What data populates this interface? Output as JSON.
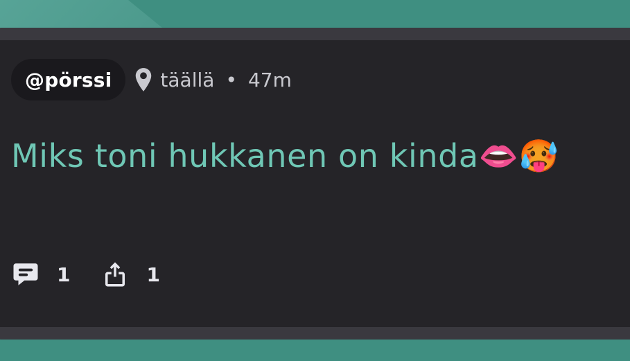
{
  "post": {
    "username": "@pörssi",
    "location": "täällä",
    "separator": "•",
    "age": "47m",
    "text": "Miks toni hukkanen on kinda👄🥵",
    "actions": {
      "comments_count": "1",
      "shares_count": "1"
    }
  },
  "icons": {
    "location": "map-pin-icon",
    "comments": "speech-bubble-icon",
    "share": "share-icon"
  },
  "colors": {
    "background": "#3f8f81",
    "card": "#252428",
    "card_border": "#3a393f",
    "accent_text": "#6fc7b5",
    "muted_text": "#c9c9cf",
    "pill_bg": "#1a191d"
  }
}
